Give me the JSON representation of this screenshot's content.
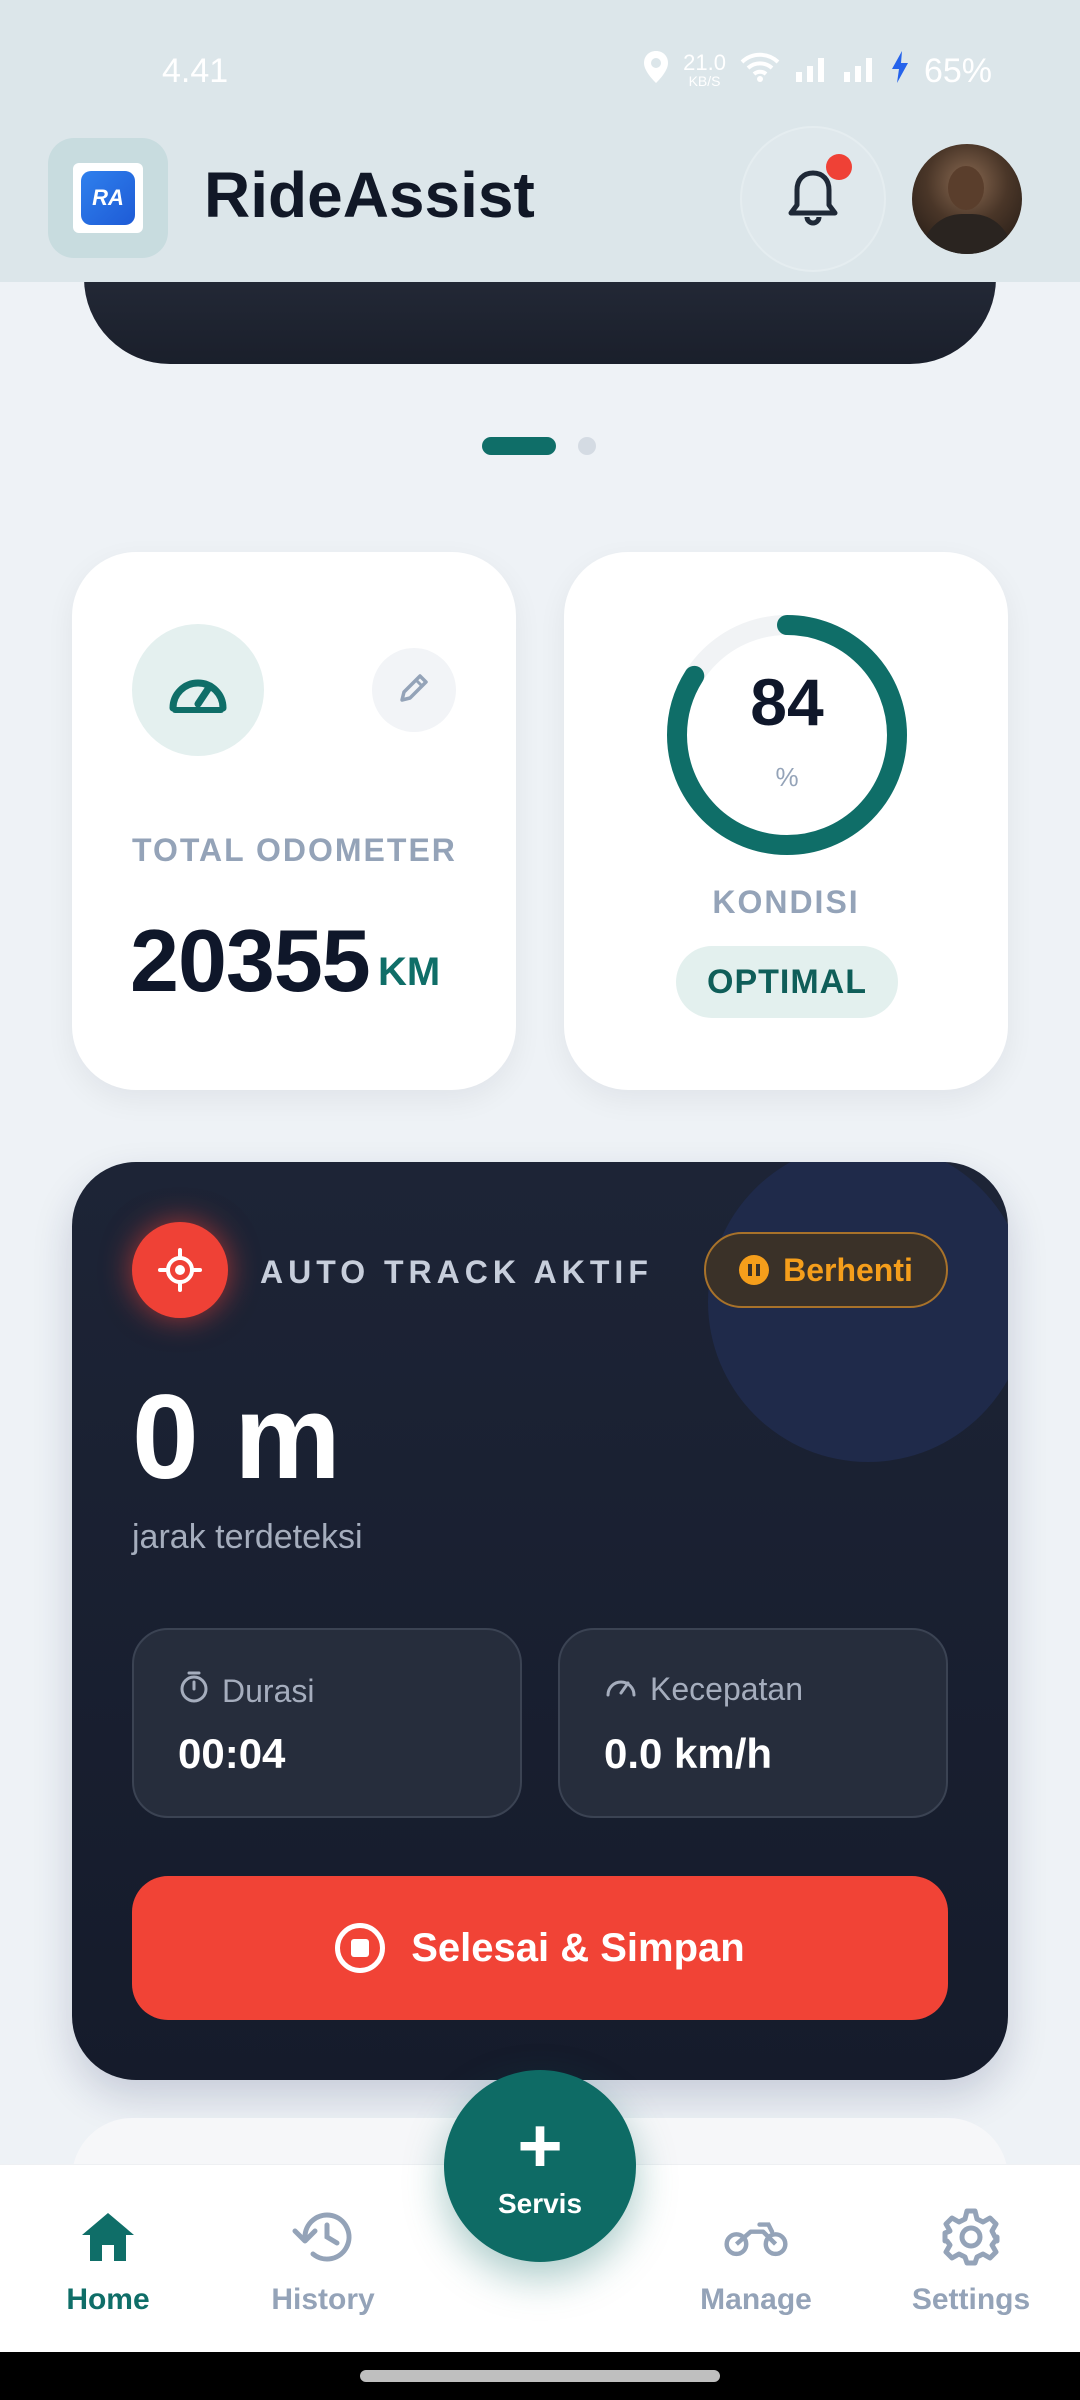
{
  "status_bar": {
    "time": "4.41",
    "net_speed_value": "21.0",
    "net_speed_unit": "KB/S",
    "battery": "65%"
  },
  "header": {
    "app_name": "RideAssist",
    "logo_text": "RA",
    "notification_badge": true
  },
  "carousel": {
    "pages": 2,
    "active_index": 0
  },
  "odometer": {
    "label": "TOTAL ODOMETER",
    "value": "20355",
    "unit": "KM"
  },
  "condition": {
    "value": "84",
    "percent_symbol": "%",
    "label": "KONDISI",
    "status": "OPTIMAL",
    "progress_fraction": 0.84
  },
  "tracking": {
    "title": "AUTO TRACK AKTIF",
    "stop_label": "Berhenti",
    "distance": "0 m",
    "distance_caption": "jarak terdeteksi",
    "duration_label": "Durasi",
    "duration_value": "00:04",
    "speed_label": "Kecepatan",
    "speed_value": "0.0 km/h",
    "finish_label": "Selesai & Simpan"
  },
  "bottom_nav": {
    "items": [
      {
        "label": "Home",
        "icon": "home-icon",
        "active": true
      },
      {
        "label": "History",
        "icon": "history-icon",
        "active": false
      },
      {
        "label": "Manage",
        "icon": "motorcycle-icon",
        "active": false
      },
      {
        "label": "Settings",
        "icon": "gear-icon",
        "active": false
      }
    ],
    "fab_label": "Servis"
  },
  "colors": {
    "brand": "#0f6e68",
    "danger": "#f14336",
    "warning": "#f59e1b",
    "card_dark": "#1a2031"
  }
}
